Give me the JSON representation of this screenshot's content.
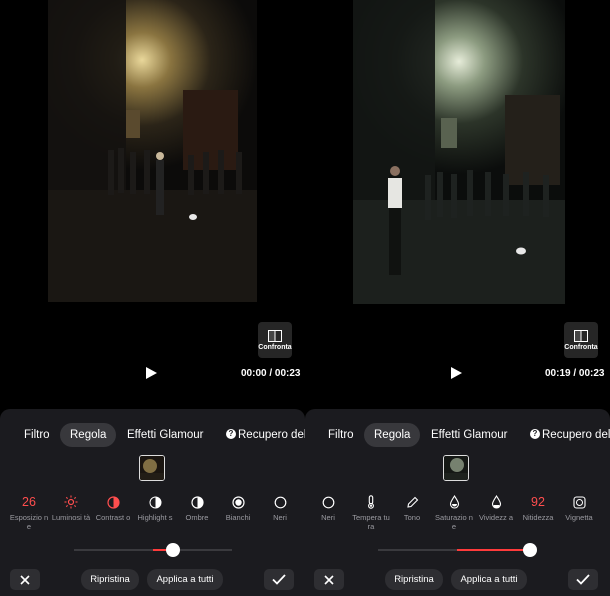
{
  "panels": [
    {
      "compare_label": "Confronta",
      "time": "00:00 / 00:23",
      "tabs": [
        "Filtro",
        "Regola",
        "Effetti Glamour",
        "Recupero del"
      ],
      "tools": [
        {
          "value": "26",
          "icon": "exposure-value",
          "name": "Esposizio ne"
        },
        {
          "value": "",
          "icon": "sun-icon",
          "name": "Luminosi tà"
        },
        {
          "value": "",
          "icon": "contrast-icon",
          "name": "Contrast o"
        },
        {
          "value": "",
          "icon": "highlights-icon",
          "name": "Highlight s"
        },
        {
          "value": "",
          "icon": "shadows-icon",
          "name": "Ombre"
        },
        {
          "value": "",
          "icon": "whites-icon",
          "name": "Bianchi"
        },
        {
          "value": "",
          "icon": "blacks-icon",
          "name": "Neri"
        }
      ],
      "slider_value": 26,
      "reset_label": "Ripristina",
      "apply_all_label": "Applica a tutti"
    },
    {
      "compare_label": "Confronta",
      "time": "00:19 / 00:23",
      "tabs": [
        "Filtro",
        "Regola",
        "Effetti Glamour",
        "Recupero del"
      ],
      "tools": [
        {
          "value": "",
          "icon": "blacks-icon",
          "name": "Neri"
        },
        {
          "value": "",
          "icon": "thermometer-icon",
          "name": "Tempera tura"
        },
        {
          "value": "",
          "icon": "eyedropper-icon",
          "name": "Tono"
        },
        {
          "value": "",
          "icon": "drop-icon",
          "name": "Saturazio ne"
        },
        {
          "value": "",
          "icon": "vibrance-icon",
          "name": "Vividezz a"
        },
        {
          "value": "92",
          "icon": "sharpness-value",
          "name": "Nitidezza"
        },
        {
          "value": "",
          "icon": "vignette-icon",
          "name": "Vignetta"
        }
      ],
      "slider_value": 92,
      "reset_label": "Ripristina",
      "apply_all_label": "Applica a tutti"
    }
  ],
  "colors": {
    "accent": "#ff3b3b",
    "sheet": "#1b1b1f",
    "chip": "#2e2e32"
  }
}
